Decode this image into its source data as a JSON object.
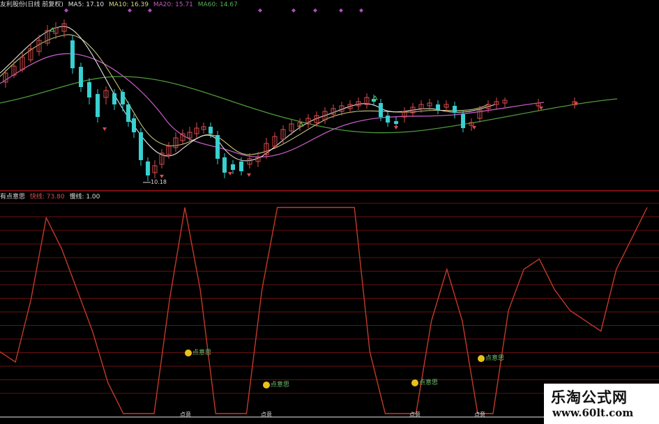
{
  "price_header": {
    "title": "友利股份(日线 前复权)",
    "ma5": "MA5: 17.10",
    "ma10": "MA10: 16.39",
    "ma20": "MA20: 15.71",
    "ma60": "MA60: 14.67"
  },
  "low_price_label": "10.18",
  "indicator_header": {
    "title": "有点意思",
    "fast": "快线: 73.80",
    "slow": "慢线: 1.00"
  },
  "signal_label": "点意思",
  "bottom_label": "点意",
  "watermark": {
    "line1": "乐淘公式网",
    "line2": "www.60lt.com"
  },
  "colors": {
    "background": "#000000",
    "up_candle": "#d84b4b",
    "down_candle": "#38d0d0",
    "ma5": "#e6e6e6",
    "ma10": "#c8c87a",
    "ma20": "#c05bc0",
    "ma60": "#4f9a3a",
    "fast_line": "#c23a2a",
    "signal": "#e8c21a"
  },
  "chart_data": {
    "type": "line",
    "series": [
      {
        "name": "快线",
        "values": [
          30,
          25,
          55,
          95,
          80,
          60,
          40,
          15,
          0,
          0,
          0,
          55,
          100,
          60,
          0,
          0,
          0,
          60,
          100,
          100,
          100,
          100,
          100,
          100,
          30,
          0,
          0,
          0,
          45,
          70,
          45,
          0,
          0,
          50,
          70,
          75,
          60,
          50,
          45,
          40,
          70,
          85,
          100
        ]
      }
    ]
  }
}
